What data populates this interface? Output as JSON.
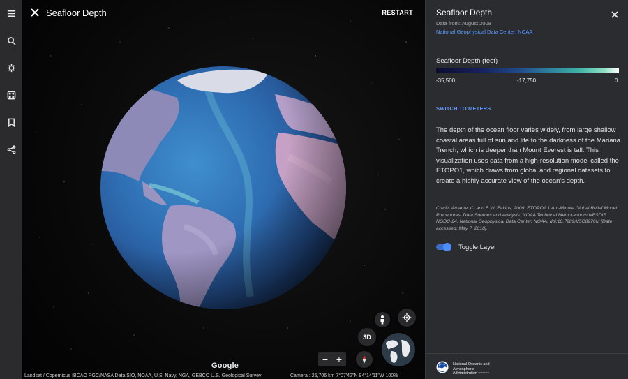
{
  "rail": {
    "items": [
      {
        "name": "menu-icon"
      },
      {
        "name": "search-icon"
      },
      {
        "name": "voyager-icon"
      },
      {
        "name": "feeling-lucky-icon"
      },
      {
        "name": "projects-icon"
      },
      {
        "name": "share-icon"
      }
    ]
  },
  "viewport": {
    "title": "Seafloor Depth",
    "restart_label": "RESTART",
    "btn_3d": "3D",
    "zoom_out": "−",
    "zoom_in": "+",
    "google_logo": "Google",
    "attribution": "Landsat / Copernicus  IBCAO  PGC/NASA  Data SIO, NOAA, U.S. Navy, NGA, GEBCO  U.S. Geological Survey",
    "camera": "Camera : 25,706 km    7°07'42\"N 94°14'11\"W    100%"
  },
  "panel": {
    "title": "Seafloor Depth",
    "date": "Data from: August 2008",
    "source": "National Geophysical Data Center, NOAA",
    "legend_title": "Seafloor Depth (feet)",
    "legend_min": "-35,500",
    "legend_mid": "-17,750",
    "legend_max": "0",
    "switch_units": "SWITCH TO METERS",
    "description": "The depth of the ocean floor varies widely, from large shallow coastal areas full of sun and life to the darkness of the Mariana Trench, which is deeper than Mount Everest is tall. This visualization uses data from a high-resolution model called the ETOPO1, which draws from global and regional datasets to create a highly accurate view of the ocean's depth.",
    "credit": "Credit: Amante, C. and B.W. Eakins, 2009. ETOPO1 1 Arc-Minute Global Relief Model: Procedures, Data Sources and Analysis. NOAA Technical Memorandum NESDIS NGDC-24. National Geophysical Data Center, NOAA. doi:10.7289/V5C8276M [Date accessed: May 7, 2018].",
    "toggle_label": "Toggle Layer",
    "toggle_on": true,
    "noaa_name": "National Oceanic and Atmospheric Administration",
    "noaa_sub": "U.S. Department of Commerce"
  },
  "colors": {
    "link_blue": "#5d9bff",
    "panel_bg": "#2b2c30",
    "rail_bg": "#2b2b2d"
  }
}
